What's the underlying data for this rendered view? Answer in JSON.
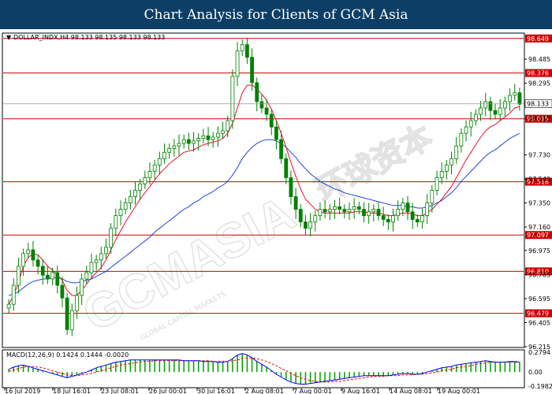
{
  "banner": {
    "title": "Chart Analysis for Clients of GCM Asia"
  },
  "colors": {
    "banner_bg": "#0c3e66",
    "candle": "#008000",
    "ma_fast": "#e8102a",
    "ma_slow": "#2244dd",
    "hline": "#cc0000",
    "macd_hist": "#00a000",
    "macd_signal": "#ff0000",
    "macd_main": "#0000ff"
  },
  "chart_data": {
    "type": "candlestick",
    "symbol_line": "DOLLAR_INDX,H4  98.133 98.135 98.133 98.133",
    "x_labels": [
      "16 Jul 2019",
      "18 Jul 16:01",
      "23 Jul 08:01",
      "26 Jul 00:01",
      "30 Jul 16:01",
      "2 Aug 08:01",
      "7 Aug 00:01",
      "9 Aug 16:01",
      "14 Aug 08:01",
      "19 Aug 00:01"
    ],
    "price_ticks": [
      "98.485",
      "98.295",
      "98.015",
      "97.730",
      "97.540",
      "97.350",
      "97.160",
      "96.975",
      "96.785",
      "96.595",
      "96.405",
      "96.215"
    ],
    "ylim": [
      96.215,
      98.685
    ],
    "last_price": "98.133",
    "levels": [
      "98.649",
      "98.376",
      "98.015",
      "97.518",
      "97.097",
      "96.810",
      "96.479"
    ],
    "closes": [
      96.55,
      96.7,
      96.85,
      96.95,
      96.98,
      96.9,
      96.85,
      96.78,
      96.75,
      96.8,
      96.7,
      96.6,
      96.35,
      96.5,
      96.62,
      96.75,
      96.8,
      96.88,
      96.9,
      96.95,
      97.0,
      97.15,
      97.25,
      97.3,
      97.35,
      97.4,
      97.45,
      97.5,
      97.55,
      97.6,
      97.65,
      97.7,
      97.75,
      97.78,
      97.8,
      97.82,
      97.85,
      97.82,
      97.84,
      97.86,
      97.88,
      97.85,
      97.87,
      97.9,
      97.92,
      98.0,
      98.35,
      98.55,
      98.6,
      98.5,
      98.3,
      98.15,
      98.1,
      98.05,
      97.95,
      97.85,
      97.7,
      97.55,
      97.4,
      97.3,
      97.2,
      97.15,
      97.2,
      97.25,
      97.3,
      97.28,
      97.3,
      97.32,
      97.3,
      97.28,
      97.3,
      97.32,
      97.3,
      97.25,
      97.28,
      97.3,
      97.25,
      97.22,
      97.2,
      97.25,
      97.3,
      97.35,
      97.28,
      97.22,
      97.2,
      97.25,
      97.35,
      97.45,
      97.55,
      97.6,
      97.65,
      97.7,
      97.8,
      97.9,
      97.95,
      98.0,
      98.05,
      98.1,
      98.15,
      98.08,
      98.05,
      98.1,
      98.15,
      98.2,
      98.22,
      98.13
    ],
    "ma_fast": [
      96.55,
      96.62,
      96.72,
      96.85,
      96.92,
      96.95,
      96.94,
      96.9,
      96.85,
      96.82,
      96.78,
      96.74,
      96.66,
      96.62,
      96.62,
      96.66,
      96.71,
      96.76,
      96.8,
      96.84,
      96.9,
      96.98,
      97.06,
      97.13,
      97.2,
      97.26,
      97.32,
      97.38,
      97.43,
      97.48,
      97.53,
      97.58,
      97.62,
      97.66,
      97.69,
      97.72,
      97.75,
      97.76,
      97.77,
      97.79,
      97.81,
      97.82,
      97.83,
      97.84,
      97.86,
      97.9,
      97.98,
      98.1,
      98.22,
      98.28,
      98.28,
      98.25,
      98.21,
      98.16,
      98.09,
      98.0,
      97.9,
      97.79,
      97.67,
      97.56,
      97.46,
      97.38,
      97.34,
      97.3,
      97.28,
      97.27,
      97.27,
      97.27,
      97.27,
      97.27,
      97.27,
      97.28,
      97.28,
      97.28,
      97.27,
      97.27,
      97.27,
      97.26,
      97.25,
      97.25,
      97.26,
      97.27,
      97.27,
      97.26,
      97.25,
      97.25,
      97.27,
      97.3,
      97.34,
      97.38,
      97.43,
      97.48,
      97.55,
      97.62,
      97.69,
      97.75,
      97.81,
      97.87,
      97.92,
      97.95,
      97.97,
      98.0,
      98.03,
      98.06,
      98.1,
      98.11
    ],
    "ma_slow": [
      96.62,
      96.63,
      96.65,
      96.68,
      96.71,
      96.73,
      96.74,
      96.75,
      96.75,
      96.76,
      96.76,
      96.75,
      96.73,
      96.72,
      96.72,
      96.73,
      96.74,
      96.75,
      96.77,
      96.79,
      96.81,
      96.84,
      96.87,
      96.9,
      96.93,
      96.96,
      96.99,
      97.02,
      97.05,
      97.08,
      97.12,
      97.15,
      97.18,
      97.21,
      97.24,
      97.27,
      97.3,
      97.32,
      97.35,
      97.37,
      97.4,
      97.42,
      97.44,
      97.47,
      97.49,
      97.52,
      97.57,
      97.63,
      97.7,
      97.75,
      97.79,
      97.82,
      97.84,
      97.85,
      97.85,
      97.84,
      97.82,
      97.79,
      97.75,
      97.71,
      97.66,
      97.62,
      97.58,
      97.55,
      97.52,
      97.5,
      97.48,
      97.46,
      97.45,
      97.43,
      97.42,
      97.41,
      97.4,
      97.39,
      97.38,
      97.37,
      97.36,
      97.35,
      97.34,
      97.33,
      97.33,
      97.33,
      97.32,
      97.32,
      97.31,
      97.31,
      97.32,
      97.33,
      97.35,
      97.37,
      97.4,
      97.43,
      97.47,
      97.52,
      97.56,
      97.6,
      97.64,
      97.68,
      97.72,
      97.75,
      97.77,
      97.8,
      97.83,
      97.86,
      97.88,
      97.9
    ],
    "macd": {
      "label": "MACD(12,26,9) 0.1424 0.1444 -0.0020",
      "ylim": [
        -0.1982,
        0.2794
      ],
      "ticks": [
        "0.2794",
        "0.00",
        "-0.1982"
      ],
      "main": [
        0.04,
        0.07,
        0.09,
        0.1,
        0.08,
        0.06,
        0.04,
        0.02,
        0.0,
        -0.02,
        -0.04,
        -0.06,
        -0.08,
        -0.06,
        -0.04,
        -0.02,
        0.0,
        0.03,
        0.06,
        0.08,
        0.1,
        0.12,
        0.14,
        0.15,
        0.16,
        0.17,
        0.17,
        0.17,
        0.17,
        0.17,
        0.17,
        0.17,
        0.17,
        0.17,
        0.17,
        0.17,
        0.16,
        0.16,
        0.16,
        0.16,
        0.15,
        0.15,
        0.15,
        0.14,
        0.14,
        0.15,
        0.19,
        0.24,
        0.26,
        0.24,
        0.2,
        0.15,
        0.11,
        0.07,
        0.02,
        -0.03,
        -0.07,
        -0.11,
        -0.14,
        -0.16,
        -0.17,
        -0.17,
        -0.16,
        -0.15,
        -0.14,
        -0.13,
        -0.12,
        -0.11,
        -0.1,
        -0.09,
        -0.08,
        -0.07,
        -0.06,
        -0.05,
        -0.05,
        -0.05,
        -0.05,
        -0.05,
        -0.05,
        -0.04,
        -0.03,
        -0.02,
        -0.02,
        -0.03,
        -0.03,
        -0.02,
        0.0,
        0.02,
        0.04,
        0.06,
        0.07,
        0.08,
        0.1,
        0.11,
        0.12,
        0.13,
        0.14,
        0.15,
        0.16,
        0.15,
        0.14,
        0.14,
        0.14,
        0.15,
        0.15,
        0.14
      ],
      "signal": [
        0.01,
        0.03,
        0.05,
        0.07,
        0.08,
        0.08,
        0.07,
        0.06,
        0.04,
        0.02,
        0.0,
        -0.02,
        -0.04,
        -0.05,
        -0.05,
        -0.04,
        -0.03,
        -0.02,
        0.0,
        0.02,
        0.04,
        0.06,
        0.08,
        0.1,
        0.11,
        0.12,
        0.13,
        0.14,
        0.15,
        0.15,
        0.16,
        0.16,
        0.16,
        0.16,
        0.16,
        0.16,
        0.16,
        0.16,
        0.16,
        0.16,
        0.16,
        0.16,
        0.15,
        0.15,
        0.15,
        0.15,
        0.16,
        0.17,
        0.19,
        0.2,
        0.2,
        0.19,
        0.17,
        0.15,
        0.12,
        0.09,
        0.05,
        0.02,
        -0.02,
        -0.05,
        -0.08,
        -0.1,
        -0.12,
        -0.13,
        -0.14,
        -0.14,
        -0.14,
        -0.13,
        -0.13,
        -0.12,
        -0.11,
        -0.1,
        -0.09,
        -0.08,
        -0.07,
        -0.06,
        -0.06,
        -0.06,
        -0.05,
        -0.05,
        -0.05,
        -0.04,
        -0.04,
        -0.04,
        -0.03,
        -0.03,
        -0.02,
        -0.01,
        0.0,
        0.02,
        0.03,
        0.04,
        0.06,
        0.07,
        0.08,
        0.09,
        0.11,
        0.12,
        0.13,
        0.14,
        0.14,
        0.14,
        0.14,
        0.14,
        0.14,
        0.14
      ]
    }
  },
  "watermark": {
    "brand": "GCMASIA",
    "cn": "环球资本",
    "sub": "GLOBAL CAPITAL MARKETS"
  }
}
